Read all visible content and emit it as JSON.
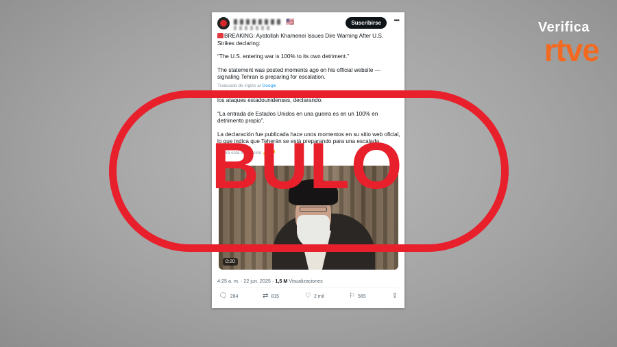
{
  "brand": {
    "verifica": "Verifica",
    "rtve": "rtve"
  },
  "tweet": {
    "flag": "🇺🇸",
    "subscribe_label": "Suscribirse",
    "more_label": "•••",
    "en_headline": "BREAKING: Ayatollah Khamenei Issues Dire Warning After U.S. Strikes declaring:",
    "en_quote": "“The U.S. entering war is 100% to its own detriment.”",
    "en_statement": "The statement was posted moments ago on his official website — signaling Tehran is preparing for escalation.",
    "translated_by": "Traducido de inglés al",
    "translator": "Google",
    "es_headline": "ÚLTIMA HORA: El Ayatolá Jamenei lanza una dura advertencia tras los ataques estadounidenses, declarando:",
    "es_quote": "“La entrada de Estados Unidos en una guerra es en un 100% en detrimento propio”.",
    "es_statement": "La declaración fue publicada hace unos momentos en su sitio web oficial, lo que indica que Teherán se está preparando para una escalada.",
    "rate_label": "Valora esta traducción",
    "video_time": "0:20",
    "time": "4:25 a. m.",
    "date": "22 jun. 2025",
    "views_count": "1,5 M",
    "views_label": "Visualizaciones",
    "replies": "284",
    "reposts": "815",
    "likes": "2 mil",
    "bookmarks": "565"
  },
  "stamp": {
    "label": "BULO",
    "color": "#e8202c"
  },
  "colors": {
    "rtve_orange": "#f26a21",
    "stamp_red": "#e8202c"
  }
}
